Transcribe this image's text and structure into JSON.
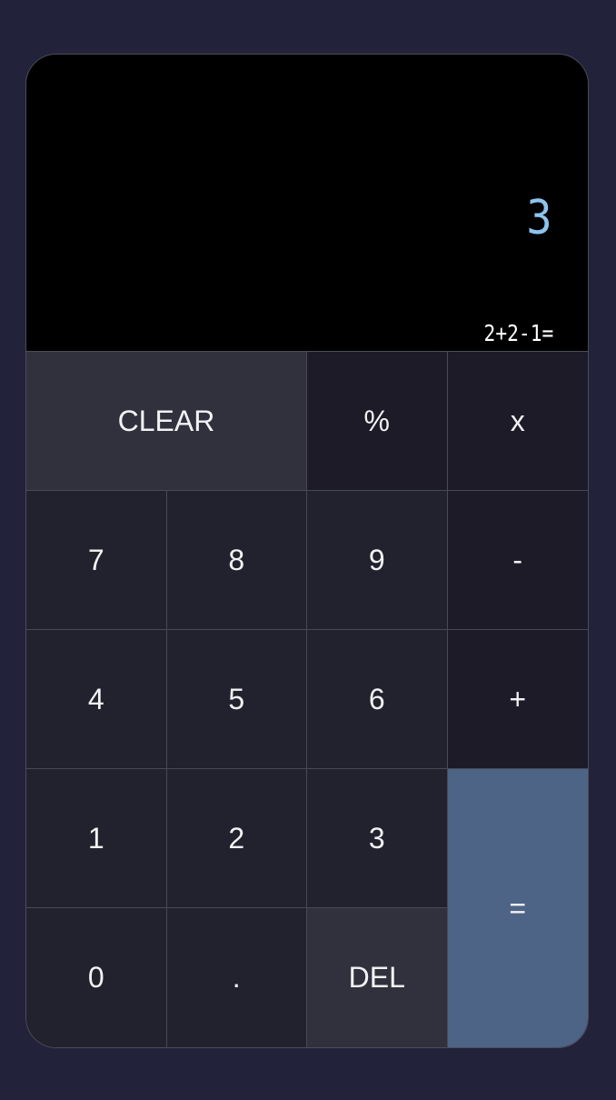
{
  "display": {
    "result": "3",
    "expression": "2+2-1="
  },
  "keys": {
    "clear": "CLEAR",
    "percent": "%",
    "multiply": "x",
    "seven": "7",
    "eight": "8",
    "nine": "9",
    "minus": "-",
    "four": "4",
    "five": "5",
    "six": "6",
    "plus": "+",
    "one": "1",
    "two": "2",
    "three": "3",
    "equals": "=",
    "zero": "0",
    "decimal": ".",
    "delete": "DEL"
  },
  "colors": {
    "background": "#22233a",
    "display_background": "#000000",
    "result_text": "#8cc4ee",
    "expression_text": "#ffffff",
    "key_background": "#21222d",
    "operator_key_background": "#1c1b27",
    "function_key_background": "#31313e",
    "equals_key_background": "#4e6486"
  }
}
